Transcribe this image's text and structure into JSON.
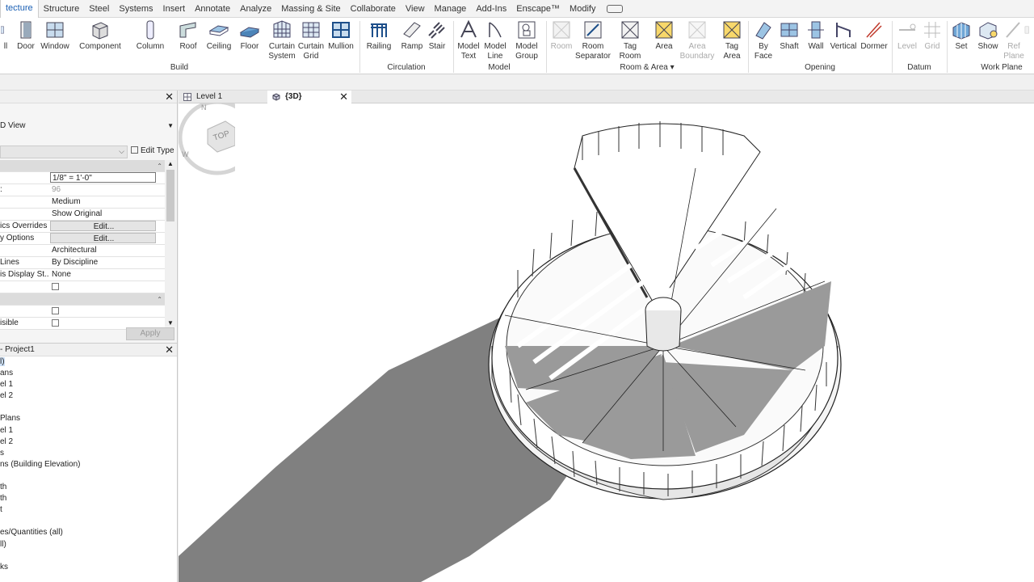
{
  "menu": {
    "tabs": [
      "tecture",
      "Structure",
      "Steel",
      "Systems",
      "Insert",
      "Annotate",
      "Analyze",
      "Massing & Site",
      "Collaborate",
      "View",
      "Manage",
      "Add-Ins",
      "Enscape™",
      "Modify"
    ],
    "active_index": 0
  },
  "ribbon": {
    "build": {
      "label": "Build",
      "tools": [
        {
          "line1": "ll",
          "line2": ""
        },
        {
          "line1": "Door",
          "line2": ""
        },
        {
          "line1": "Window",
          "line2": ""
        },
        {
          "line1": "Component",
          "line2": ""
        },
        {
          "line1": "Column",
          "line2": ""
        },
        {
          "line1": "Roof",
          "line2": ""
        },
        {
          "line1": "Ceiling",
          "line2": ""
        },
        {
          "line1": "Floor",
          "line2": ""
        },
        {
          "line1": "Curtain",
          "line2": "System"
        },
        {
          "line1": "Curtain",
          "line2": "Grid"
        },
        {
          "line1": "Mullion",
          "line2": ""
        }
      ]
    },
    "circulation": {
      "label": "Circulation",
      "tools": [
        {
          "line1": "Railing",
          "line2": ""
        },
        {
          "line1": "Ramp",
          "line2": ""
        },
        {
          "line1": "Stair",
          "line2": ""
        }
      ]
    },
    "model": {
      "label": "Model",
      "tools": [
        {
          "line1": "Model",
          "line2": "Text"
        },
        {
          "line1": "Model",
          "line2": "Line"
        },
        {
          "line1": "Model",
          "line2": "Group"
        }
      ]
    },
    "room_area": {
      "label": "Room & Area",
      "tools": [
        {
          "line1": "Room",
          "line2": ""
        },
        {
          "line1": "Room",
          "line2": "Separator"
        },
        {
          "line1": "Tag",
          "line2": "Room"
        },
        {
          "line1": "Area",
          "line2": ""
        },
        {
          "line1": "Area",
          "line2": "Boundary"
        },
        {
          "line1": "Tag",
          "line2": "Area"
        }
      ]
    },
    "opening": {
      "label": "Opening",
      "tools": [
        {
          "line1": "By",
          "line2": "Face"
        },
        {
          "line1": "Shaft",
          "line2": ""
        },
        {
          "line1": "Wall",
          "line2": ""
        },
        {
          "line1": "Vertical",
          "line2": ""
        },
        {
          "line1": "Dormer",
          "line2": ""
        }
      ]
    },
    "datum": {
      "label": "Datum",
      "tools": [
        {
          "line1": "Level",
          "line2": ""
        },
        {
          "line1": "Grid",
          "line2": ""
        }
      ]
    },
    "work_plane": {
      "label": "Work Plane",
      "tools": [
        {
          "line1": "Set",
          "line2": ""
        },
        {
          "line1": "Show",
          "line2": ""
        },
        {
          "line1": "Ref",
          "line2": "Plane"
        },
        {
          "line1": "",
          "line2": ""
        }
      ]
    }
  },
  "properties": {
    "view_type": "D View",
    "edit_type_label": "Edit Type",
    "rows": [
      {
        "key": "",
        "value": "1/8\" = 1'-0\"",
        "style": "boxed"
      },
      {
        "key": ":",
        "value": "96",
        "style": "dim"
      },
      {
        "key": "",
        "value": "Medium",
        "style": ""
      },
      {
        "key": "",
        "value": "Show Original",
        "style": ""
      },
      {
        "key": "ics Overrides",
        "value": "Edit...",
        "style": "btn"
      },
      {
        "key": "y Options",
        "value": "Edit...",
        "style": "btn"
      },
      {
        "key": "",
        "value": "Architectural",
        "style": ""
      },
      {
        "key": "Lines",
        "value": "By Discipline",
        "style": ""
      },
      {
        "key": "is Display St...",
        "value": "None",
        "style": ""
      }
    ],
    "apply_label": "Apply"
  },
  "browser": {
    "title": "- Project1",
    "items": [
      "l)",
      "ans",
      "el 1",
      "el 2",
      "",
      "Plans",
      "el 1",
      "el 2",
      "s",
      "ns (Building Elevation)",
      "",
      "th",
      "th",
      "t",
      "",
      "es/Quantities (all)",
      "ll)",
      "",
      "ks"
    ],
    "selected_index": 0,
    "last_row_key": "isible"
  },
  "view_tabs": [
    {
      "label": "Level 1",
      "active": false
    },
    {
      "label": "{3D}",
      "active": true
    }
  ],
  "viewcube": {
    "face_label": "TOP",
    "compass_n": "N",
    "compass_w": "W"
  },
  "colors": {
    "accent": "#1a5fb4",
    "shadow": "#808080",
    "ribbon_bg": "#ffffff"
  }
}
